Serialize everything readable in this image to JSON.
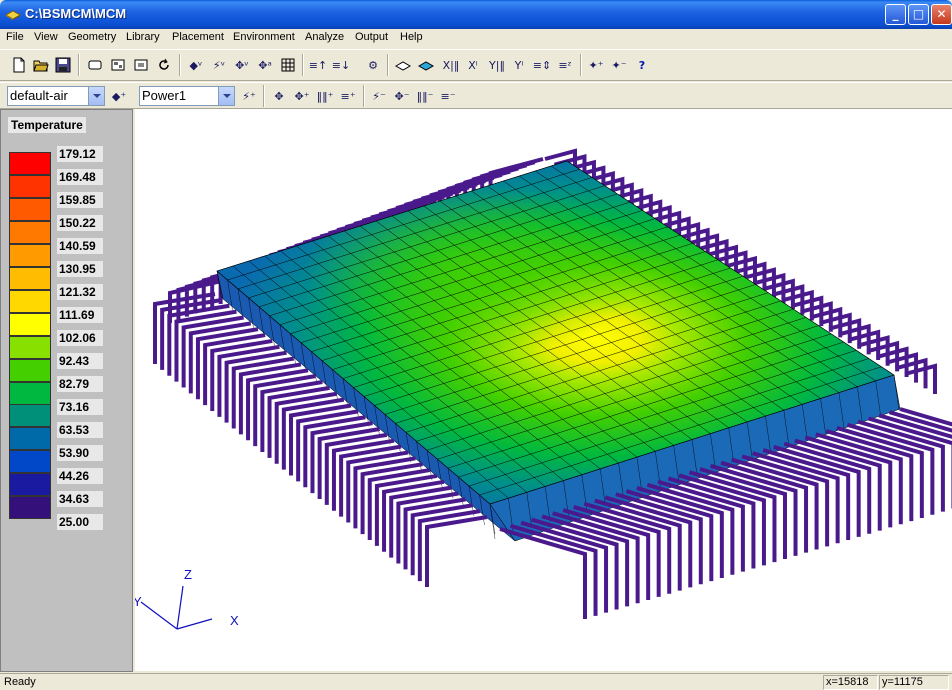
{
  "window": {
    "title": "C:\\BSMCM\\MCM",
    "minimize": "_",
    "maximize": "□",
    "close": "✕"
  },
  "menu": [
    "File",
    "View",
    "Geometry",
    "Library",
    "Placement",
    "Environment",
    "Analyze",
    "Output",
    "Help"
  ],
  "toolbar2": {
    "material_value": "default-air",
    "power_value": "Power1"
  },
  "legend": {
    "title": "Temperature",
    "values": [
      "179.12",
      "169.48",
      "159.85",
      "150.22",
      "140.59",
      "130.95",
      "121.32",
      "111.69",
      "102.06",
      "92.43",
      "82.79",
      "73.16",
      "63.53",
      "53.90",
      "44.26",
      "34.63",
      "25.00"
    ],
    "colors": [
      "#ff0000",
      "#ff3300",
      "#ff5a00",
      "#ff7800",
      "#ff9a00",
      "#ffbc00",
      "#ffd800",
      "#ffff00",
      "#88e000",
      "#44d000",
      "#00b840",
      "#008f78",
      "#006aa8",
      "#0048c8",
      "#1a1aa0",
      "#33107a"
    ]
  },
  "axes": {
    "x": "X",
    "z": "Z",
    "y": "Y"
  },
  "status": {
    "text": "Ready",
    "x_coord": "x=15818",
    "y_coord": "y=11175"
  }
}
